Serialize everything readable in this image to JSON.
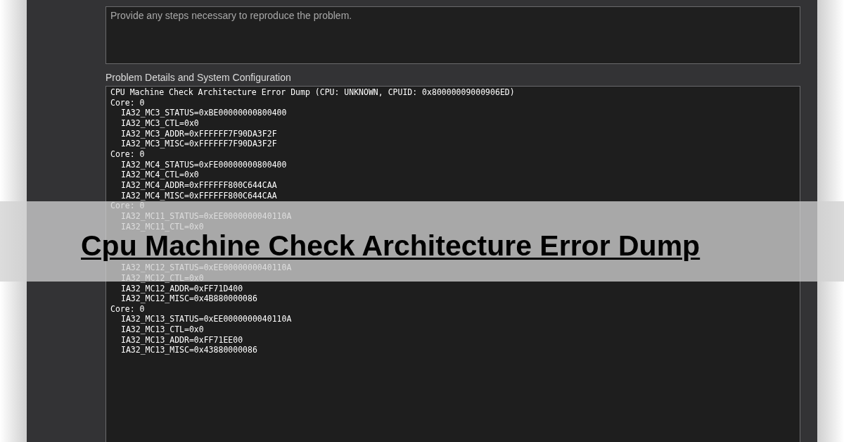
{
  "steps_field": {
    "placeholder": "Provide any steps necessary to reproduce the problem."
  },
  "details": {
    "label": "Problem Details and System Configuration",
    "blocks": [
      {
        "lines": [
          {
            "kind": "header",
            "text": "CPU Machine Check Architecture Error Dump (CPU: UNKNOWN, CPUID: 0x80000009000906ED)"
          },
          {
            "kind": "core",
            "text": "Core: 0"
          },
          {
            "kind": "register",
            "text": "IA32_MC3_STATUS=0xBE00000000800400"
          },
          {
            "kind": "register",
            "text": "IA32_MC3_CTL=0x0"
          },
          {
            "kind": "register",
            "text": "IA32_MC3_ADDR=0xFFFFFF7F90DA3F2F"
          },
          {
            "kind": "register",
            "text": "IA32_MC3_MISC=0xFFFFFF7F90DA3F2F"
          },
          {
            "kind": "core",
            "text": "Core: 0"
          },
          {
            "kind": "register",
            "text": "IA32_MC4_STATUS=0xFE00000000800400"
          },
          {
            "kind": "register",
            "text": "IA32_MC4_CTL=0x0"
          },
          {
            "kind": "register",
            "text": "IA32_MC4_ADDR=0xFFFFFF800C644CAA"
          },
          {
            "kind": "register",
            "text": "IA32_MC4_MISC=0xFFFFFF800C644CAA"
          },
          {
            "kind": "core",
            "text": "Core: 0"
          },
          {
            "kind": "register",
            "text": "IA32_MC11_STATUS=0xEE0000000040110A"
          },
          {
            "kind": "register",
            "text": "IA32_MC11_CTL=0x0"
          }
        ]
      },
      {
        "lines": [
          {
            "kind": "register",
            "text": "IA32_MC12_STATUS=0xEE0000000040110A"
          },
          {
            "kind": "register",
            "text": "IA32_MC12_CTL=0x0"
          },
          {
            "kind": "register",
            "text": "IA32_MC12_ADDR=0xFF71D400"
          },
          {
            "kind": "register",
            "text": "IA32_MC12_MISC=0x4B880000086"
          },
          {
            "kind": "core",
            "text": "Core: 0"
          },
          {
            "kind": "register",
            "text": "IA32_MC13_STATUS=0xEE0000000040110A"
          },
          {
            "kind": "register",
            "text": "IA32_MC13_CTL=0x0"
          },
          {
            "kind": "register",
            "text": "IA32_MC13_ADDR=0xFF71EE00"
          },
          {
            "kind": "register",
            "text": "IA32_MC13_MISC=0x43880000086"
          }
        ]
      }
    ]
  },
  "banner": {
    "title": "Cpu Machine Check Architecture Error Dump"
  }
}
